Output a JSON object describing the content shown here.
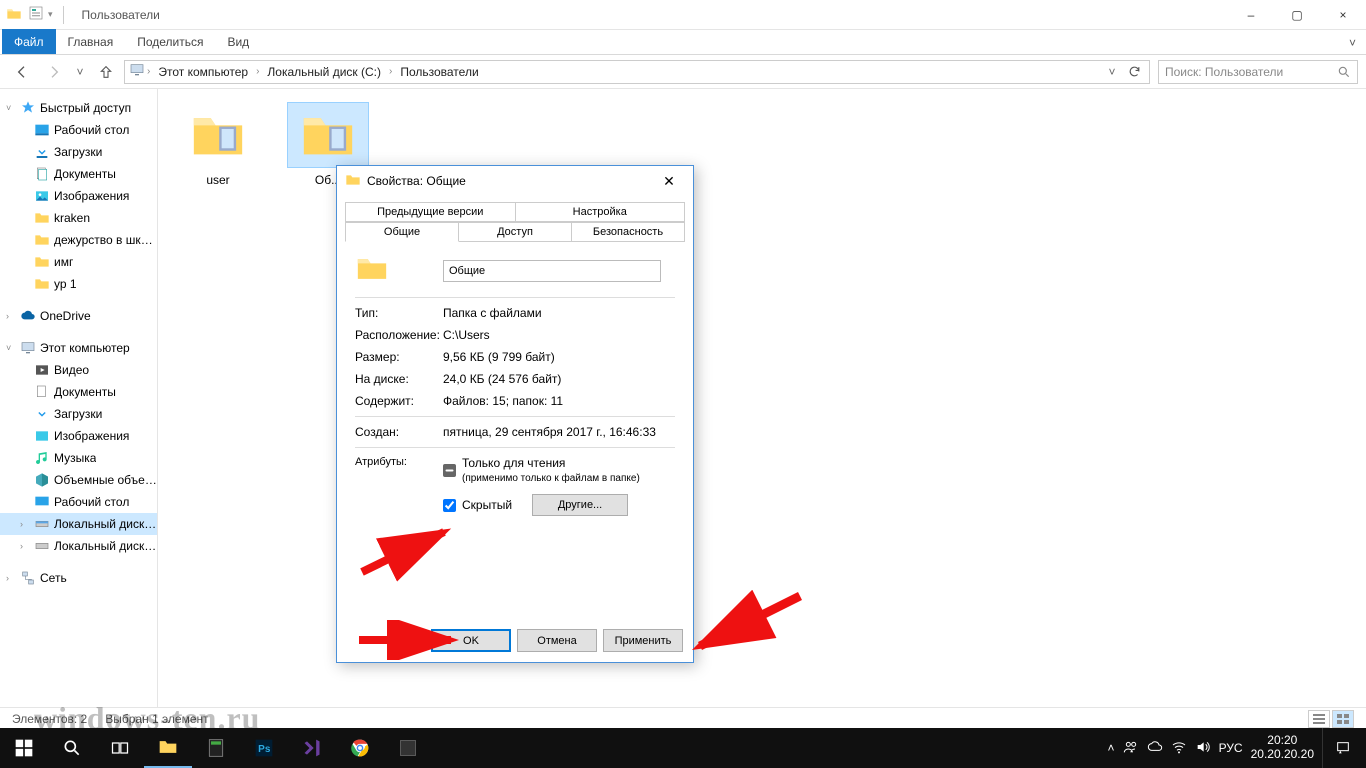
{
  "window": {
    "title": "Пользователи",
    "min": "–",
    "max": "▢",
    "close": "×"
  },
  "ribbon": {
    "file": "Файл",
    "tabs": [
      "Главная",
      "Поделиться",
      "Вид"
    ]
  },
  "nav": {
    "crumbs": [
      "Этот компьютер",
      "Локальный диск (C:)",
      "Пользователи"
    ],
    "search_placeholder": "Поиск: Пользователи"
  },
  "tree": {
    "quick_access": "Быстрый доступ",
    "quick_items": [
      "Рабочий стол",
      "Загрузки",
      "Документы",
      "Изображения",
      "kraken",
      "дежурство в школе",
      "имг",
      "ур 1"
    ],
    "onedrive": "OneDrive",
    "this_pc": "Этот компьютер",
    "pc_items": [
      "Видео",
      "Документы",
      "Загрузки",
      "Изображения",
      "Музыка",
      "Объемные объекты",
      "Рабочий стол",
      "Локальный диск (C:)",
      "Локальный диск (E:)"
    ],
    "network": "Сеть"
  },
  "folders": [
    {
      "name": "user"
    },
    {
      "name": "Об..."
    }
  ],
  "status": {
    "count": "Элементов: 2",
    "selected": "Выбран 1 элемент"
  },
  "dialog": {
    "title": "Свойства: Общие",
    "tabs_top": [
      "Предыдущие версии",
      "Настройка"
    ],
    "tabs_bottom": [
      "Общие",
      "Доступ",
      "Безопасность"
    ],
    "folder_name": "Общие",
    "rows": {
      "type_k": "Тип:",
      "type_v": "Папка с файлами",
      "loc_k": "Расположение:",
      "loc_v": "C:\\Users",
      "size_k": "Размер:",
      "size_v": "9,56 КБ (9 799 байт)",
      "ondisk_k": "На диске:",
      "ondisk_v": "24,0 КБ (24 576 байт)",
      "contains_k": "Содержит:",
      "contains_v": "Файлов: 15; папок: 11",
      "created_k": "Создан:",
      "created_v": "пятница, 29 сентября 2017 г., 16:46:33",
      "attr_k": "Атрибуты:",
      "readonly": "Только для чтения",
      "readonly_sub": "(применимо только к файлам в папке)",
      "hidden": "Скрытый",
      "other": "Другие..."
    },
    "buttons": {
      "ok": "OK",
      "cancel": "Отмена",
      "apply": "Применить"
    }
  },
  "taskbar": {
    "lang": "РУС",
    "time": "20:20",
    "date": "20.20.20.20"
  },
  "watermark": "windows-ten.ru"
}
